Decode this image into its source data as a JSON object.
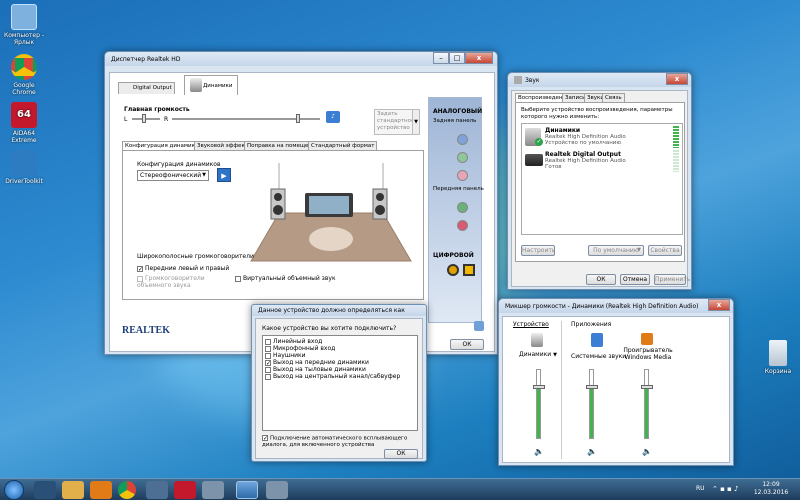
{
  "desktop": {
    "icons": [
      {
        "label": "Компьютер - Ярлык",
        "color": "#7fb1de"
      },
      {
        "label": "Google Chrome",
        "color": "#e04a3a"
      },
      {
        "label": "AIDA64 Extreme",
        "color": "#c4192c"
      },
      {
        "label": "DriverToolkit",
        "color": "#2d7bc1"
      },
      {
        "label": "Корзина",
        "color": "#cfd8e2"
      }
    ]
  },
  "realtek": {
    "title": "Диспетчер Realtek HD",
    "tabs": [
      "Digital Output",
      "Динамики"
    ],
    "volume": {
      "label": "Главная громкость",
      "left": "L",
      "right": "R",
      "level": 0.85
    },
    "default_device": "Задать стандартное устройство",
    "inner_tabs": [
      "Конфигурация динамиков",
      "Звуковой эффект",
      "Поправка на помещение",
      "Стандартный формат"
    ],
    "config_label": "Конфигурация динамиков",
    "config_value": "Стереофонический",
    "wideband_label": "Широкополосные громкоговорители",
    "front_lr": "Передние левый и правый",
    "surround": "Громкоговорители объемного звука",
    "virtual": "Виртуальный объемный звук",
    "analog": "АНАЛОГОВЫЙ",
    "rear": "Задняя панель",
    "front": "Передняя панель",
    "digital": "ЦИФРОВОЙ",
    "brand": "REALTEK",
    "ok": "ОК"
  },
  "dialog": {
    "title": "Данное устройство должно определяться как",
    "question": "Какое устройство вы хотите подключить?",
    "options": [
      "Линейный вход",
      "Микрофонный вход",
      "Наушники",
      "Выход на передние динамики",
      "Выход на тыловые динамики",
      "Выход на центральный канал/сабвуфер"
    ],
    "checked_index": 3,
    "auto_popup": "Подключение автоматического всплывающего диалога, для включенного устройства",
    "ok": "ОК"
  },
  "sound": {
    "title": "Звук",
    "tabs": [
      "Воспроизведение",
      "Запись",
      "Звуки",
      "Связь"
    ],
    "prompt": "Выберите устройство воспроизведения, параметры которого нужно изменить:",
    "devices": [
      {
        "name": "Динамики",
        "desc": "Realtek High Definition Audio",
        "status": "Устройство по умолчанию"
      },
      {
        "name": "Realtek Digital Output",
        "desc": "Realtek High Definition Audio",
        "status": "Готов"
      }
    ],
    "configure": "Настроить",
    "default": "По умолчанию",
    "properties": "Свойства",
    "ok": "ОК",
    "cancel": "Отмена",
    "apply": "Применить"
  },
  "mixer": {
    "title": "Микшер громкости - Динамики (Realtek High Definition Audio)",
    "device_header": "Устройство",
    "apps_header": "Приложения",
    "channels": [
      {
        "name": "Динамики",
        "level": 0.75
      },
      {
        "name": "Системные звуки",
        "level": 0.75
      },
      {
        "name": "Проигрыватель Windows Media",
        "level": 0.75
      }
    ]
  },
  "taskbar": {
    "lang": "RU",
    "time": "12:09",
    "date": "12.03.2016"
  }
}
